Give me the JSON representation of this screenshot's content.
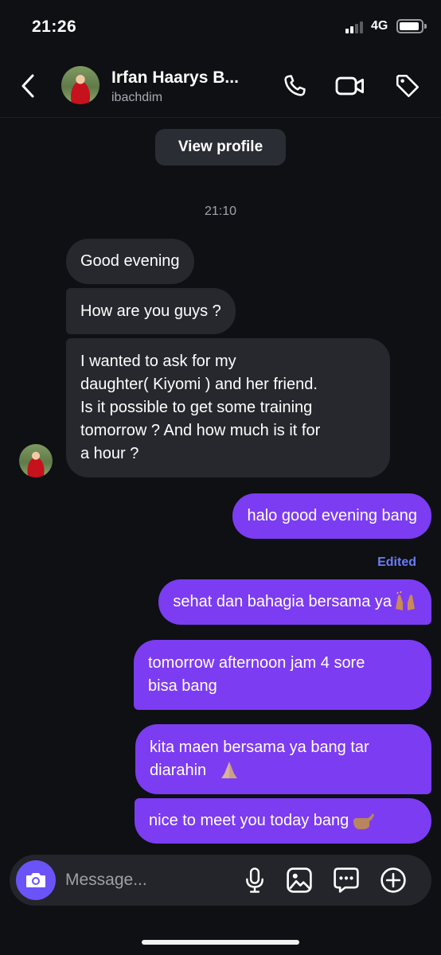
{
  "status_bar": {
    "time": "21:26",
    "network": "4G"
  },
  "header": {
    "contact_name": "Irfan Haarys B...",
    "username": "ibachdim",
    "icons": [
      "back-chevron-icon",
      "phone-icon",
      "video-camera-icon",
      "tag-icon"
    ]
  },
  "view_profile_label": "View profile",
  "timestamp": "21:10",
  "messages": [
    {
      "direction": "in",
      "text": "Good evening"
    },
    {
      "direction": "in",
      "text": "How are you guys ?"
    },
    {
      "direction": "in",
      "text": "I wanted to ask for my\ndaughter( Kiyomi ) and her friend.\nIs it possible to get some training\ntomorrow ? And how much is it for\na hour ?"
    },
    {
      "direction": "out",
      "text": "halo good evening bang"
    },
    {
      "direction": "out",
      "text": "sehat dan bahagia bersama ya",
      "emoji": "raising-hands-emoji"
    },
    {
      "direction": "out",
      "text": "tomorrow afternoon jam 4 sore\nbisa bang"
    },
    {
      "direction": "out",
      "text": "kita maen bersama ya bang tar\ndiarahin",
      "emoji": "folded-hands-emoji"
    },
    {
      "direction": "out",
      "text": "nice to meet you today bang",
      "emoji": "call-me-hand-emoji"
    }
  ],
  "edited_label": "Edited",
  "composer": {
    "placeholder": "Message...",
    "icons": [
      "camera-icon",
      "microphone-icon",
      "image-icon",
      "sticker-chat-icon",
      "plus-circle-icon"
    ]
  },
  "colors": {
    "background": "#0e1014",
    "incoming_bubble": "#26282d",
    "outgoing_bubble": "#7c3cf2",
    "camera_button": "#6a53f7",
    "edited_label": "#6b7cf6"
  }
}
